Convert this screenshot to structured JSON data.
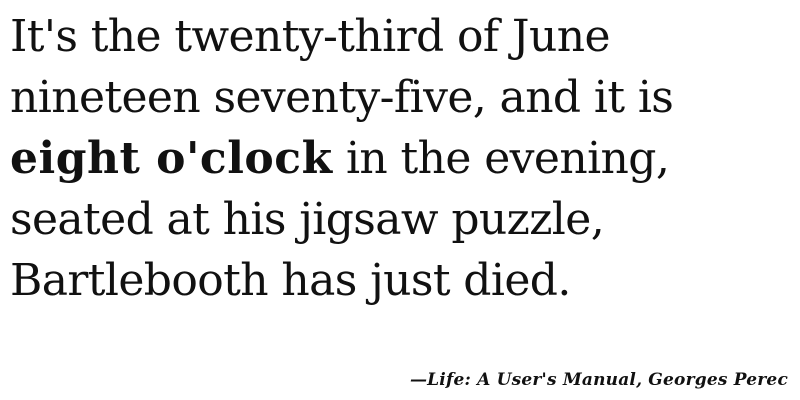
{
  "quote": {
    "line1": "It's the twenty-third of June",
    "line2": "nineteen seventy-five, and it is",
    "line3_emphasis": "eight o'clock",
    "line3_rest": " in the evening,",
    "line4": "seated at his jigsaw puzzle,",
    "line5": "Bartlebooth has just died."
  },
  "attribution": "—Life: A User's Manual, Georges Perec"
}
